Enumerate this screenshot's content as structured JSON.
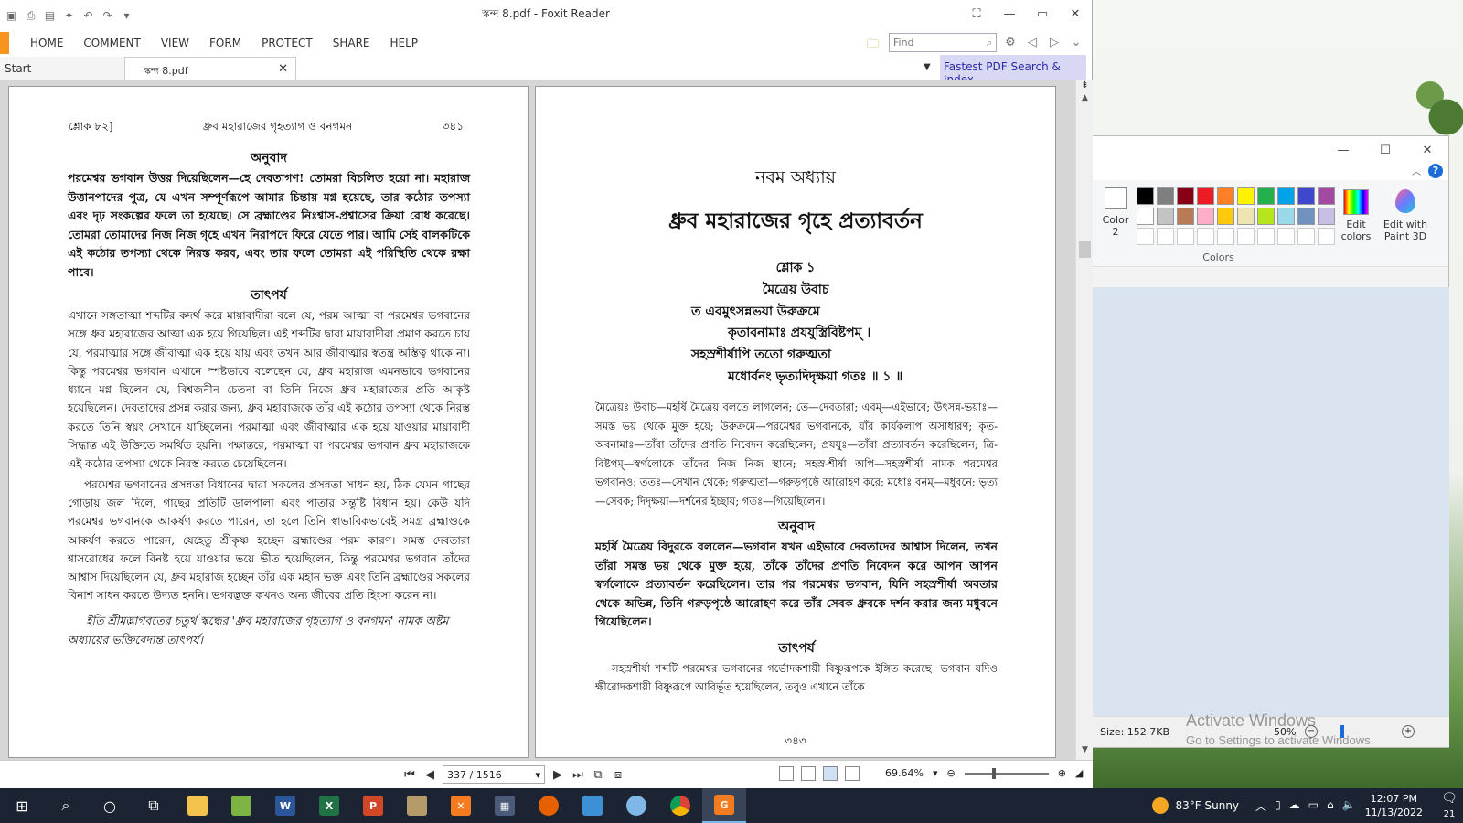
{
  "foxit": {
    "title": "স্কন্দ 8.pdf - Foxit Reader",
    "menu": [
      "HOME",
      "COMMENT",
      "VIEW",
      "FORM",
      "PROTECT",
      "SHARE",
      "HELP"
    ],
    "find_placeholder": "Find",
    "tabs": {
      "start": "Start",
      "doc": "স্কন্দ 8.pdf"
    },
    "ad": "Fastest PDF Search & Index",
    "page_indicator": "337 / 1516",
    "zoom": "69.64%"
  },
  "left_page": {
    "header_left": "শ্লোক ৮২]",
    "header_center": "ধ্রুব মহারাজের গৃহত্যাগ ও বনগমন",
    "header_right": "৩৪১",
    "anubad_title": "অনুবাদ",
    "anubad_text": "পরমেশ্বর ভগবান উত্তর দিয়েছিলেন—হে দেবতাগণ! তোমরা বিচলিত হয়ো না। মহারাজ উত্তানপাদের পুত্র, যে এখন সম্পূর্ণরূপে আমার চিন্তায় মগ্ন হয়েছে, তার কঠোর তপস্যা এবং দৃঢ় সংকল্পের ফলে তা হয়েছে। সে ব্রহ্মাণ্ডের নিঃশ্বাস-প্রশ্বাসের ক্রিয়া রোধ করেছে। তোমরা তোমাদের নিজ নিজ গৃহে এখন নিরাপদে ফিরে যেতে পার। আমি সেই বালকটিকে এই কঠোর তপস্যা থেকে নিরস্ত করব, এবং তার ফলে তোমরা এই পরিস্থিতি থেকে রক্ষা পাবে।",
    "tatparya_title": "তাৎপর্য",
    "tatparya_p1": "এখানে সঙ্গতাত্মা শব্দটির কদর্থ করে মায়াবাদীরা বলে যে, পরম আত্মা বা পরমেশ্বর ভগবানের সঙ্গে ধ্রুব মহারাজের আত্মা এক হয়ে গিয়েছিল। এই শব্দটির দ্বারা মায়াবাদীরা প্রমাণ করতে চায় যে, পরমাত্মার সঙ্গে জীবাত্মা এক হয়ে যায় এবং তখন আর জীবাত্মার স্বতন্ত্র অস্তিত্ব থাকে না। কিন্তু পরমেশ্বর ভগবান এখানে স্পষ্টভাবে বলেছেন যে, ধ্রুব মহারাজ এমনভাবে ভগবানের ধ্যানে মগ্ন ছিলেন যে, বিশ্বজনীন চেতনা বা তিনি নিজে ধ্রুব মহারাজের প্রতি আকৃষ্ট হয়েছিলেন। দেবতাদের প্রসন্ন করার জন্য, ধ্রুব মহারাজকে তাঁর এই কঠোর তপস্যা থেকে নিরস্ত করতে তিনি স্বয়ং সেখানে যাচ্ছিলেন। পরমাত্মা এবং জীবাত্মার এক হয়ে যাওয়ার মায়াবাদী সিদ্ধান্ত এই উক্তিতে সমর্থিত হয়নি। পক্ষান্তরে, পরমাত্মা বা পরমেশ্বর ভগবান ধ্রুব মহারাজকে এই কঠোর তপস্যা থেকে নিরস্ত করতে চেয়েছিলেন।",
    "tatparya_p2": "পরমেশ্বর ভগবানের প্রসন্নতা বিধানের দ্বারা সকলের প্রসন্নতা সাধন হয়, ঠিক যেমন গাছের গোড়ায় জল দিলে, গাছের প্রতিটি ডালপালা এবং পাতার সন্তুষ্টি বিধান হয়। কেউ যদি পরমেশ্বর ভগবানকে আকর্ষণ করতে পারেন, তা হলে তিনি স্বাভাবিকভাবেই সমগ্র ব্রহ্মাণ্ডকে আকর্ষণ করতে পারেন, যেহেতু শ্রীকৃষ্ণ হচ্ছেন ব্রহ্মাণ্ডের পরম কারণ। সমস্ত দেবতারা শ্বাসরোধের ফলে বিনষ্ট হয়ে যাওয়ার ভয়ে ভীত হয়েছিলেন, কিন্তু পরমেশ্বর ভগবান তাঁদের আশ্বাস দিয়েছিলেন যে, ধ্রুব মহারাজ হচ্ছেন তাঁর এক মহান ভক্ত এবং তিনি ব্রহ্মাণ্ডের সকলের বিনাশ সাধন করতে উদ্যত হননি। ভগবদ্ভক্ত কখনও অন্য জীবের প্রতি হিংসা করেন না।",
    "closing": "ইতি শ্রীমদ্ভাগবতের চতুর্থ স্কন্ধের 'ধ্রুব মহারাজের গৃহত্যাগ ও বনগমন' নামক অষ্টম অধ্যায়ের ভক্তিবেদান্ত তাৎপর্য।"
  },
  "right_page": {
    "chapter_num": "নবম অধ্যায়",
    "chapter_title": "ধ্রুব মহারাজের গৃহে প্রত্যাবর্তন",
    "verse_label": "শ্লোক ১",
    "verse_speaker": "মৈত্রেয় উবাচ",
    "verse_l1": "ত এবমুৎসন্নভয়া উরুক্রমে",
    "verse_l2": "কৃতাবনামাঃ প্রযযুস্ত্রিবিষ্টপম্ ।",
    "verse_l3": "সহস্রশীর্ষাপি ততো গরুত্মতা",
    "verse_l4": "মধোর্বনং ভৃত্যদিদৃক্ষয়া গতঃ ॥ ১ ॥",
    "synonyms": "মৈত্রেয়ঃ উবাচ—মহর্ষি মৈত্রেয় বলতে লাগলেন; তে—দেবতারা; এবম্—এইভাবে; উৎসন্ন-ভয়াঃ—সমস্ত ভয় থেকে মুক্ত হয়ে; উরুক্রমে—পরমেশ্বর ভগবানকে, যাঁর কার্যকলাপ অসাধারণ; কৃত-অবনামাঃ—তাঁরা তাঁদের প্রণতি নিবেদন করেছিলেন; প্রযযুঃ—তাঁরা প্রত্যাবর্তন করেছিলেন; ত্রি-বিষ্টপম্—স্বর্গলোকে তাঁদের নিজ নিজ স্থানে; সহস্র-শীর্ষা অপি—সহস্রশীর্ষা নামক পরমেশ্বর ভগবানও; ততঃ—সেখান থেকে; গরুত্মতা—গরুড়পৃষ্ঠে আরোহণ করে; মধোঃ বনম্—মধুবনে; ভৃত্য—সেবক; দিদৃক্ষয়া—দর্শনের ইচ্ছায়; গতঃ—গিয়েছিলেন।",
    "anubad_title": "অনুবাদ",
    "anubad_text": "মহর্ষি মৈত্রেয় বিদুরকে বললেন—ভগবান যখন এইভাবে দেবতাদের আশ্বাস দিলেন, তখন তাঁরা সমস্ত ভয় থেকে মুক্ত হয়ে, তাঁকে তাঁদের প্রণতি নিবেদন করে আপন আপন স্বর্গলোকে প্রত্যাবর্তন করেছিলেন। তার পর পরমেশ্বর ভগবান, যিনি সহস্রশীর্ষা অবতার থেকে অভিন্ন, তিনি গরুড়পৃষ্ঠে আরোহণ করে তাঁর সেবক ধ্রুবকে দর্শন করার জন্য মধুবনে গিয়েছিলেন।",
    "tatparya_title": "তাৎপর্য",
    "tatparya_text": "সহস্রশীর্ষা শব্দটি পরমেশ্বর ভগবানের গর্ভোদকশায়ী বিষ্ণুরূপকে ইঙ্গিত করেছে। ভগবান যদিও ক্ষীরোদকশায়ী বিষ্ণুরূপে আবির্ভূত হয়েছিলেন, তবুও এখানে তাঁকে",
    "page_number": "৩৪৩"
  },
  "paint": {
    "color2_label": "Color 2",
    "colors_label": "Colors",
    "edit_colors": "Edit colors",
    "edit_paint3d": "Edit with Paint 3D",
    "size": "Size: 152.7KB",
    "zoom": "50%",
    "palette_row1": [
      "#000000",
      "#7f7f7f",
      "#880015",
      "#ed1c24",
      "#ff7f27",
      "#fff200",
      "#22b14c",
      "#00a2e8",
      "#3f48cc",
      "#a349a4"
    ],
    "palette_row2": [
      "#ffffff",
      "#c3c3c3",
      "#b97a57",
      "#ffaec9",
      "#ffc90e",
      "#efe4b0",
      "#b5e61d",
      "#99d9ea",
      "#7092be",
      "#c8bfe7"
    ]
  },
  "watermark": {
    "line1": "Activate Windows",
    "line2": "Go to Settings to activate Windows."
  },
  "taskbar": {
    "weather": "83°F  Sunny",
    "time": "12:07 PM",
    "date": "11/13/2022",
    "notification_count": "21"
  }
}
